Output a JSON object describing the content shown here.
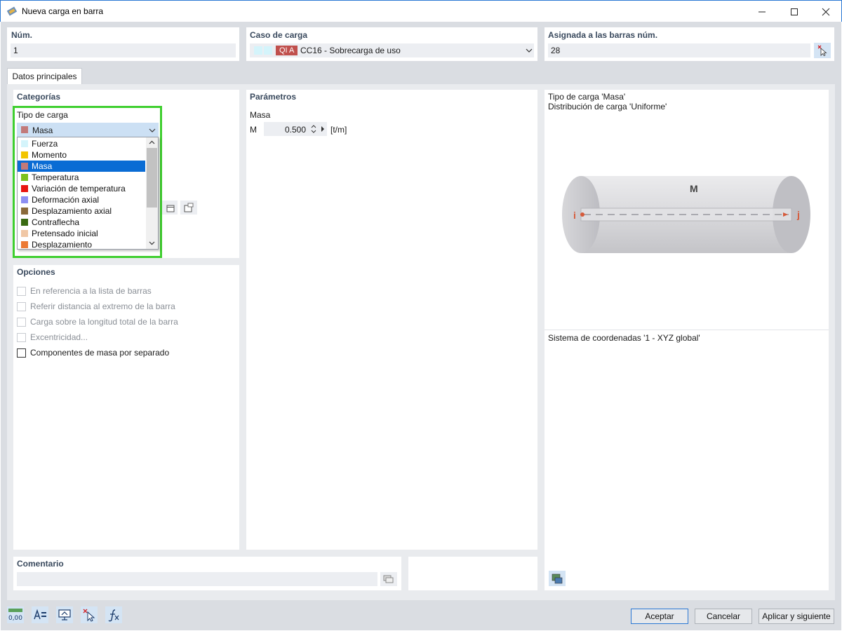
{
  "window": {
    "title": "Nueva carga en barra"
  },
  "header": {
    "num": {
      "label": "Núm.",
      "value": "1"
    },
    "load_case": {
      "label": "Caso de carga",
      "badge": "QI A",
      "value": "CC16 - Sobrecarga de uso",
      "badge_color": "#c0504d"
    },
    "assigned": {
      "label": "Asignada a las barras núm.",
      "value": "28"
    }
  },
  "tabs": [
    {
      "label": "Datos principales"
    }
  ],
  "categories": {
    "title": "Categorías",
    "load_type_label": "Tipo de carga",
    "selected": "Masa",
    "selected_color": "#c27a7a",
    "options": [
      {
        "label": "Fuerza",
        "color": "#d4f4fb"
      },
      {
        "label": "Momento",
        "color": "#f2c500"
      },
      {
        "label": "Masa",
        "color": "#c27a7a"
      },
      {
        "label": "Temperatura",
        "color": "#7cc11d"
      },
      {
        "label": "Variación de temperatura",
        "color": "#e8140f"
      },
      {
        "label": "Deformación axial",
        "color": "#8d8ff2"
      },
      {
        "label": "Desplazamiento axial",
        "color": "#8a6a3a"
      },
      {
        "label": "Contraflecha",
        "color": "#3a6a12"
      },
      {
        "label": "Pretensado inicial",
        "color": "#f0c7a5"
      },
      {
        "label": "Desplazamiento",
        "color": "#ec7a34"
      }
    ]
  },
  "options": {
    "title": "Opciones",
    "items": [
      {
        "label": "En referencia a la lista de barras",
        "enabled": false
      },
      {
        "label": "Referir distancia al extremo de la barra",
        "enabled": false
      },
      {
        "label": "Carga sobre la longitud total de la barra",
        "enabled": false
      },
      {
        "label": "Excentricidad...",
        "enabled": false
      },
      {
        "label": "Componentes de masa por separado",
        "enabled": true
      }
    ]
  },
  "parameters": {
    "title": "Parámetros",
    "group": "Masa",
    "symbol": "M",
    "value": "0.500",
    "unit": "[t/m]"
  },
  "preview": {
    "line1": "Tipo de carga 'Masa'",
    "line2": "Distribución de carga 'Uniforme'",
    "label_m": "M",
    "label_i": "i",
    "label_j": "j",
    "coord_system": "Sistema de coordenadas '1 - XYZ global'"
  },
  "comment": {
    "label": "Comentario",
    "value": ""
  },
  "footer": {
    "ok": "Aceptar",
    "cancel": "Cancelar",
    "apply_next": "Aplicar y siguiente",
    "units_icon_text": "0,00"
  }
}
